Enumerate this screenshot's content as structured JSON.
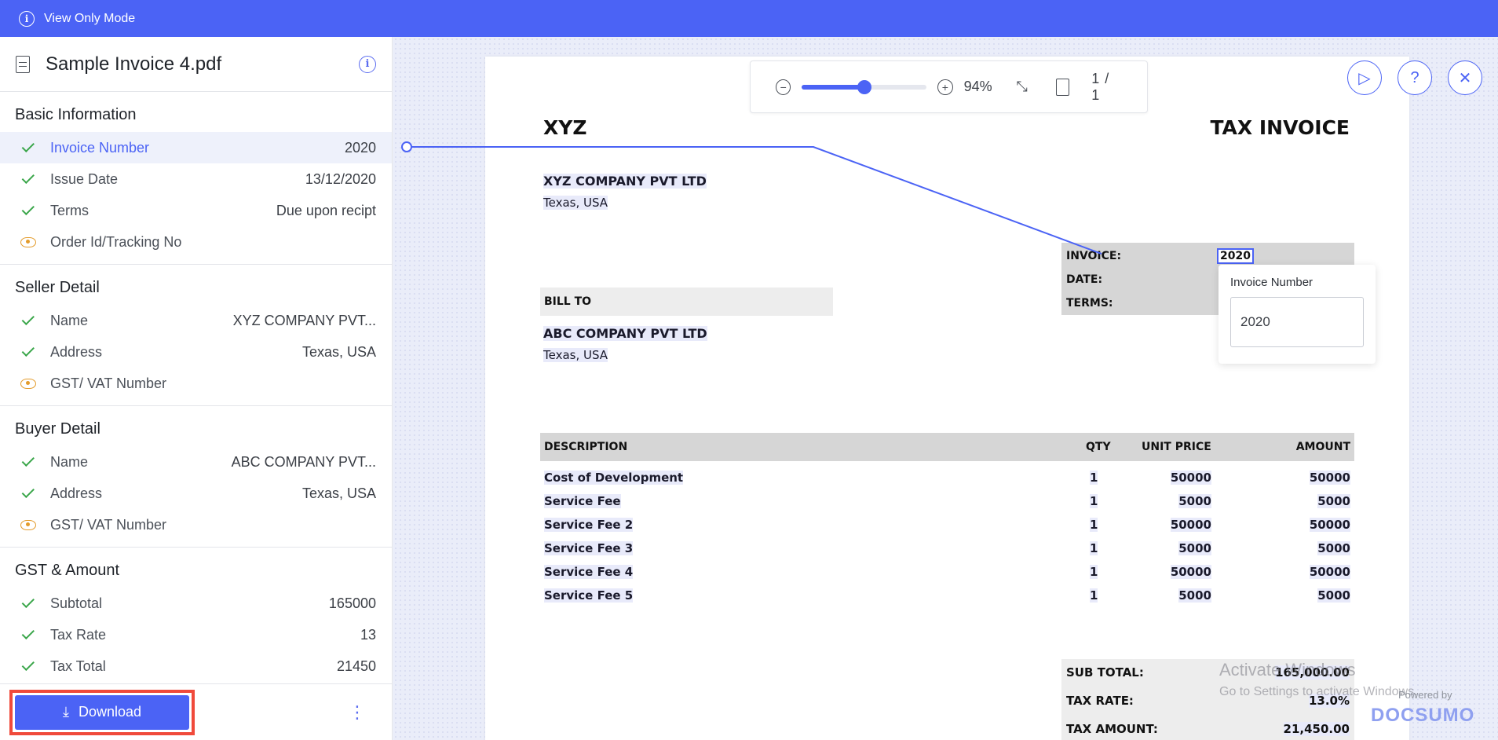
{
  "topbar": {
    "mode_label": "View Only Mode",
    "info_glyph": "i"
  },
  "document": {
    "title": "Sample Invoice 4.pdf",
    "info_glyph": "i"
  },
  "sections": [
    {
      "title": "Basic Information",
      "fields": [
        {
          "name": "Invoice Number",
          "value": "2020",
          "status": "check"
        },
        {
          "name": "Issue Date",
          "value": "13/12/2020",
          "status": "check"
        },
        {
          "name": "Terms",
          "value": "Due upon recipt",
          "status": "check"
        },
        {
          "name": "Order Id/Tracking No",
          "value": "",
          "status": "eye"
        }
      ]
    },
    {
      "title": "Seller Detail",
      "fields": [
        {
          "name": "Name",
          "value": "XYZ COMPANY PVT...",
          "status": "check"
        },
        {
          "name": "Address",
          "value": "Texas, USA",
          "status": "check"
        },
        {
          "name": "GST/ VAT Number",
          "value": "",
          "status": "eye"
        }
      ]
    },
    {
      "title": "Buyer Detail",
      "fields": [
        {
          "name": "Name",
          "value": "ABC COMPANY PVT...",
          "status": "check"
        },
        {
          "name": "Address",
          "value": "Texas, USA",
          "status": "check"
        },
        {
          "name": "GST/ VAT Number",
          "value": "",
          "status": "eye"
        }
      ]
    },
    {
      "title": "GST & Amount",
      "fields": [
        {
          "name": "Subtotal",
          "value": "165000",
          "status": "check"
        },
        {
          "name": "Tax Rate",
          "value": "13",
          "status": "check"
        },
        {
          "name": "Tax Total",
          "value": "21450",
          "status": "check"
        }
      ]
    }
  ],
  "bottom": {
    "download_label": "Download",
    "download_icon": "⤓",
    "more_icon": "⋮"
  },
  "zoom": {
    "percent": "94%",
    "level": 0.5,
    "page_label": "1 / 1",
    "zoom_out_glyph": "−",
    "zoom_in_glyph": "+",
    "fit_glyph": "⤡"
  },
  "controls": {
    "play_glyph": "▷",
    "help_glyph": "?",
    "close_glyph": "✕"
  },
  "invoice": {
    "seller_short": "XYZ",
    "doc_type": "TAX INVOICE",
    "seller_name": "XYZ COMPANY PVT LTD",
    "seller_address": "Texas, USA",
    "invoice_label": "INVOICE:",
    "invoice_value": "2020",
    "date_label": "DATE:",
    "terms_label": "TERMS:",
    "bill_to_label": "BILL TO",
    "buyer_name": "ABC COMPANY PVT LTD",
    "buyer_address": "Texas, USA",
    "headers": {
      "description": "DESCRIPTION",
      "qty": "QTY",
      "unit_price": "UNIT PRICE",
      "amount": "AMOUNT"
    },
    "items": [
      {
        "description": "Cost of Development",
        "qty": "1",
        "unit_price": "50000",
        "amount": "50000"
      },
      {
        "description": "Service Fee",
        "qty": "1",
        "unit_price": "5000",
        "amount": "5000"
      },
      {
        "description": "Service Fee 2",
        "qty": "1",
        "unit_price": "50000",
        "amount": "50000"
      },
      {
        "description": "Service Fee 3",
        "qty": "1",
        "unit_price": "5000",
        "amount": "5000"
      },
      {
        "description": "Service Fee 4",
        "qty": "1",
        "unit_price": "50000",
        "amount": "50000"
      },
      {
        "description": "Service Fee 5",
        "qty": "1",
        "unit_price": "5000",
        "amount": "5000"
      }
    ],
    "totals": {
      "subtotal_label": "SUB TOTAL:",
      "subtotal_value": "165,000.00",
      "tax_rate_label": "TAX RATE:",
      "tax_rate_value": "13.0%",
      "tax_amount_label": "TAX AMOUNT:",
      "tax_amount_value": "21,450.00"
    }
  },
  "popover": {
    "label": "Invoice Number",
    "value": "2020"
  },
  "watermark": {
    "line1": "Activate Windows",
    "line2": "Go to Settings to activate Windows."
  },
  "branding": {
    "powered_by": "Powered by",
    "brand": "DOCSUMO"
  },
  "colors": {
    "accent": "#4b63f5",
    "check": "#3aa64a",
    "eye": "#e39b2b",
    "download_highlight": "#f04a3b"
  }
}
